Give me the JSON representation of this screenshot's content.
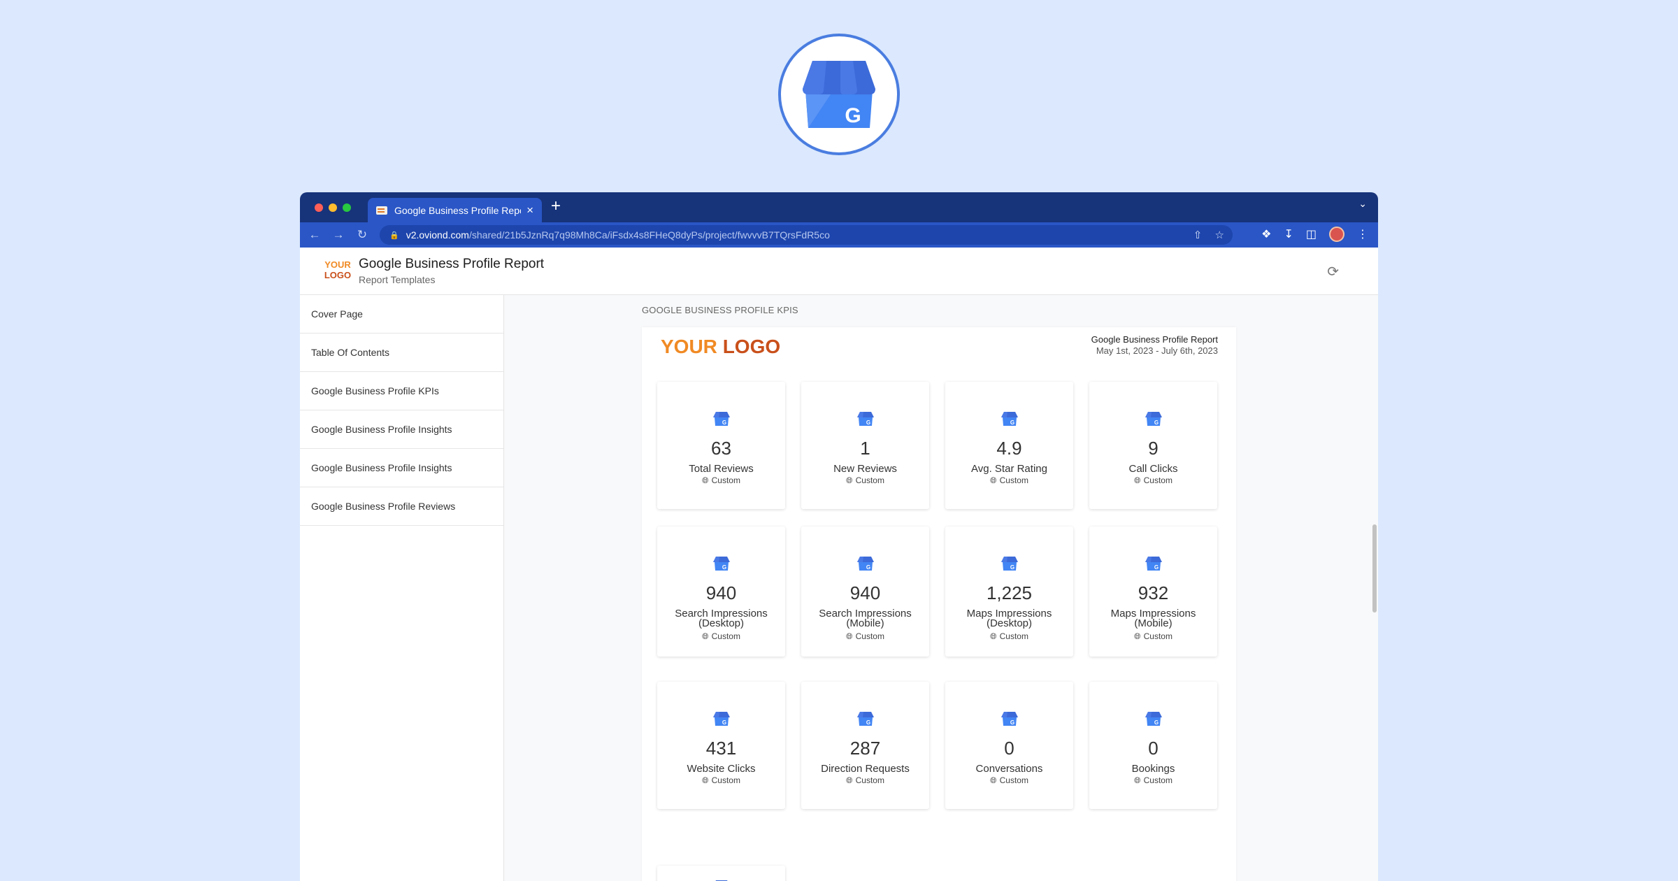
{
  "browser": {
    "tab_title": "Google Business Profile Report",
    "tab_close": "×",
    "new_tab": "+",
    "url_host": "v2.oviond.com",
    "url_path": "/shared/21b5JznRq7q98Mh8Ca/iFsdx4s8FHeQ8dyPs/project/fwvvvB7TQrsFdR5co"
  },
  "header": {
    "logo_line1": "YOUR",
    "logo_line2": "LOGO",
    "title": "Google Business Profile Report",
    "subtitle": "Report Templates"
  },
  "sidebar": {
    "items": [
      {
        "label": "Cover Page"
      },
      {
        "label": "Table Of Contents"
      },
      {
        "label": "Google Business Profile KPIs"
      },
      {
        "label": "Google Business Profile Insights"
      },
      {
        "label": "Google Business Profile Insights"
      },
      {
        "label": "Google Business Profile Reviews"
      }
    ]
  },
  "main": {
    "section_label": "GOOGLE BUSINESS PROFILE KPIS",
    "report": {
      "logo_your": "YOUR",
      "logo_logo": "LOGO",
      "title": "Google Business Profile Report",
      "dates": "May 1st, 2023 - July 6th, 2023"
    },
    "cards": [
      {
        "value": "63",
        "label": "Total Reviews",
        "tag": "Custom"
      },
      {
        "value": "1",
        "label": "New Reviews",
        "tag": "Custom"
      },
      {
        "value": "4.9",
        "label": "Avg. Star Rating",
        "tag": "Custom"
      },
      {
        "value": "9",
        "label": "Call Clicks",
        "tag": "Custom"
      },
      {
        "value": "940",
        "label": "Search Impressions (Desktop)",
        "tag": "Custom"
      },
      {
        "value": "940",
        "label": "Search Impressions (Mobile)",
        "tag": "Custom"
      },
      {
        "value": "1,225",
        "label": "Maps Impressions (Desktop)",
        "tag": "Custom"
      },
      {
        "value": "932",
        "label": "Maps Impressions (Mobile)",
        "tag": "Custom"
      },
      {
        "value": "431",
        "label": "Website Clicks",
        "tag": "Custom"
      },
      {
        "value": "287",
        "label": "Direction Requests",
        "tag": "Custom"
      },
      {
        "value": "0",
        "label": "Conversations",
        "tag": "Custom"
      },
      {
        "value": "0",
        "label": "Bookings",
        "tag": "Custom"
      }
    ]
  },
  "colors": {
    "page_bg": "#dbe8fd",
    "chrome_tabbar": "#17337a",
    "chrome_toolbar": "#2a56c6",
    "logo_orange": "#f08a24",
    "logo_dark_orange": "#c9501b",
    "gbp_blue": "#4285f4"
  }
}
